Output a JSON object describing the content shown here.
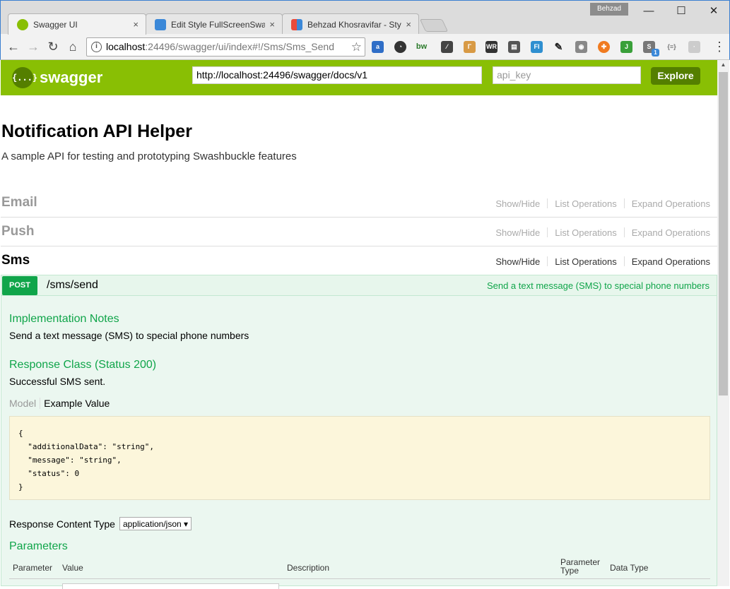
{
  "browser": {
    "tabs": [
      {
        "label": "Swagger UI",
        "close": "×"
      },
      {
        "label": "Edit Style FullScreenSwag",
        "close": "×"
      },
      {
        "label": "Behzad Khosravifar - Styl",
        "close": "×"
      }
    ],
    "profile_name": "Behzad",
    "window_controls": {
      "minimize": "—",
      "maximize": "☐",
      "close": "✕"
    },
    "url_host": "localhost",
    "url_rest": ":24496/swagger/ui/index#!/Sms/Sms_Send",
    "extension_badge": "1"
  },
  "swagger": {
    "brand": "swagger",
    "logo_glyph": "{...}",
    "spec_url": "http://localhost:24496/swagger/docs/v1",
    "api_key_placeholder": "api_key",
    "explore_label": "Explore"
  },
  "info": {
    "title": "Notification API Helper",
    "description": "A sample API for testing and prototyping Swashbuckle features"
  },
  "resources": [
    {
      "name": "Email",
      "show_hide": "Show/Hide",
      "list_ops": "List Operations",
      "expand_ops": "Expand Operations"
    },
    {
      "name": "Push",
      "show_hide": "Show/Hide",
      "list_ops": "List Operations",
      "expand_ops": "Expand Operations"
    },
    {
      "name": "Sms",
      "show_hide": "Show/Hide",
      "list_ops": "List Operations",
      "expand_ops": "Expand Operations"
    }
  ],
  "operation": {
    "method": "POST",
    "path": "/sms/send",
    "summary": "Send a text message (SMS) to special phone numbers",
    "impl_notes_heading": "Implementation Notes",
    "impl_notes": "Send a text message (SMS) to special phone numbers",
    "response_class_heading": "Response Class (Status 200)",
    "response_class_text": "Successful SMS sent.",
    "model_tab": "Model",
    "example_tab": "Example Value",
    "example_json": "{\n  \"additionalData\": \"string\",\n  \"message\": \"string\",\n  \"status\": 0\n}",
    "content_type_label": "Response Content Type",
    "content_type_value": "application/json ▾",
    "parameters_heading": "Parameters",
    "param_columns": [
      "Parameter",
      "Value",
      "Description",
      "Parameter Type",
      "Data Type"
    ]
  },
  "colors": {
    "swagger_green": "#89bf04",
    "explore_bg": "#547f00",
    "post_green": "#10a54a",
    "op_bg": "#ebf7f0",
    "sample_bg": "#fcf6db"
  }
}
